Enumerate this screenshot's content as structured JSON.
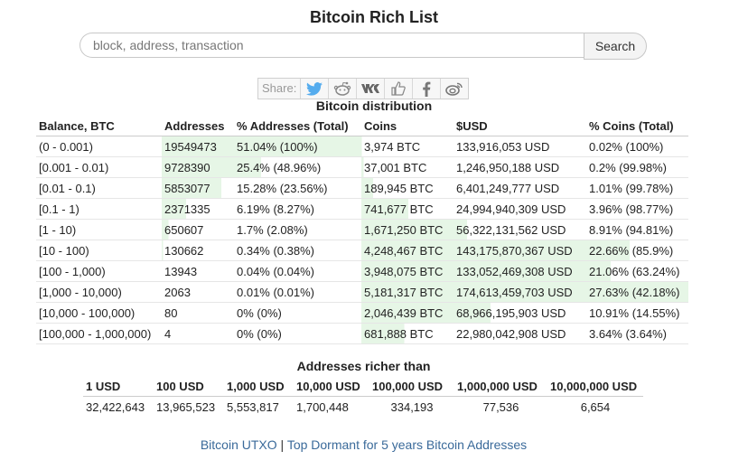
{
  "page": {
    "title": "Bitcoin Rich List"
  },
  "search": {
    "placeholder": "block, address, transaction",
    "button_label": "Search"
  },
  "share": {
    "label": "Share:",
    "icons": [
      "twitter-icon",
      "reddit-icon",
      "vk-icon",
      "like-icon",
      "facebook-icon",
      "weibo-icon"
    ]
  },
  "distribution": {
    "title": "Bitcoin distribution",
    "headers": [
      "Balance, BTC",
      "Addresses",
      "% Addresses (Total)",
      "Coins",
      "$USD",
      "% Coins (Total)"
    ],
    "rows": [
      {
        "balance": "(0 - 0.001)",
        "addresses": "19549473",
        "pct_addresses": "51.04% (100%)",
        "coins": "3,974 BTC",
        "usd": "133,916,053 USD",
        "pct_coins": "0.02% (100%)",
        "fill_addr": 51.04,
        "fill_coins": 0.02
      },
      {
        "balance": "[0.001 - 0.01)",
        "addresses": "9728390",
        "pct_addresses": "25.4% (48.96%)",
        "coins": "37,001 BTC",
        "usd": "1,246,950,188 USD",
        "pct_coins": "0.2% (99.98%)",
        "fill_addr": 25.4,
        "fill_coins": 0.2
      },
      {
        "balance": "[0.01 - 0.1)",
        "addresses": "5853077",
        "pct_addresses": "15.28% (23.56%)",
        "coins": "189,945 BTC",
        "usd": "6,401,249,777 USD",
        "pct_coins": "1.01% (99.78%)",
        "fill_addr": 15.28,
        "fill_coins": 1.01
      },
      {
        "balance": "[0.1 - 1)",
        "addresses": "2371335",
        "pct_addresses": "6.19% (8.27%)",
        "coins": "741,677 BTC",
        "usd": "24,994,940,309 USD",
        "pct_coins": "3.96% (98.77%)",
        "fill_addr": 6.19,
        "fill_coins": 3.96
      },
      {
        "balance": "[1 - 10)",
        "addresses": "650607",
        "pct_addresses": "1.7% (2.08%)",
        "coins": "1,671,250 BTC",
        "usd": "56,322,131,562 USD",
        "pct_coins": "8.91% (94.81%)",
        "fill_addr": 1.7,
        "fill_coins": 8.91
      },
      {
        "balance": "[10 - 100)",
        "addresses": "130662",
        "pct_addresses": "0.34% (0.38%)",
        "coins": "4,248,467 BTC",
        "usd": "143,175,870,367 USD",
        "pct_coins": "22.66% (85.9%)",
        "fill_addr": 0.34,
        "fill_coins": 22.66
      },
      {
        "balance": "[100 - 1,000)",
        "addresses": "13943",
        "pct_addresses": "0.04% (0.04%)",
        "coins": "3,948,075 BTC",
        "usd": "133,052,469,308 USD",
        "pct_coins": "21.06% (63.24%)",
        "fill_addr": 0.04,
        "fill_coins": 21.06
      },
      {
        "balance": "[1,000 - 10,000)",
        "addresses": "2063",
        "pct_addresses": "0.01% (0.01%)",
        "coins": "5,181,317 BTC",
        "usd": "174,613,459,703 USD",
        "pct_coins": "27.63% (42.18%)",
        "fill_addr": 0.01,
        "fill_coins": 27.63
      },
      {
        "balance": "[10,000 - 100,000)",
        "addresses": "80",
        "pct_addresses": "0% (0%)",
        "coins": "2,046,439 BTC",
        "usd": "68,966,195,903 USD",
        "pct_coins": "10.91% (14.55%)",
        "fill_addr": 0,
        "fill_coins": 10.91
      },
      {
        "balance": "[100,000 - 1,000,000)",
        "addresses": "4",
        "pct_addresses": "0% (0%)",
        "coins": "681,888 BTC",
        "usd": "22,980,042,908 USD",
        "pct_coins": "3.64% (3.64%)",
        "fill_addr": 0,
        "fill_coins": 3.64
      }
    ]
  },
  "richer": {
    "title": "Addresses richer than",
    "headers": [
      "1 USD",
      "100 USD",
      "1,000 USD",
      "10,000 USD",
      "100,000 USD",
      "1,000,000 USD",
      "10,000,000 USD"
    ],
    "values": [
      "32,422,643",
      "13,965,523",
      "5,553,817",
      "1,700,448",
      "334,193",
      "77,536",
      "6,654"
    ]
  },
  "footer": {
    "link1": "Bitcoin UTXO",
    "separator": " | ",
    "link2": "Top Dormant for 5 years Bitcoin Addresses"
  },
  "colors": {
    "fill": "#e6f6e6",
    "link": "#3a6a9a",
    "twitter": "#55acee",
    "icon_gray": "#888888"
  }
}
